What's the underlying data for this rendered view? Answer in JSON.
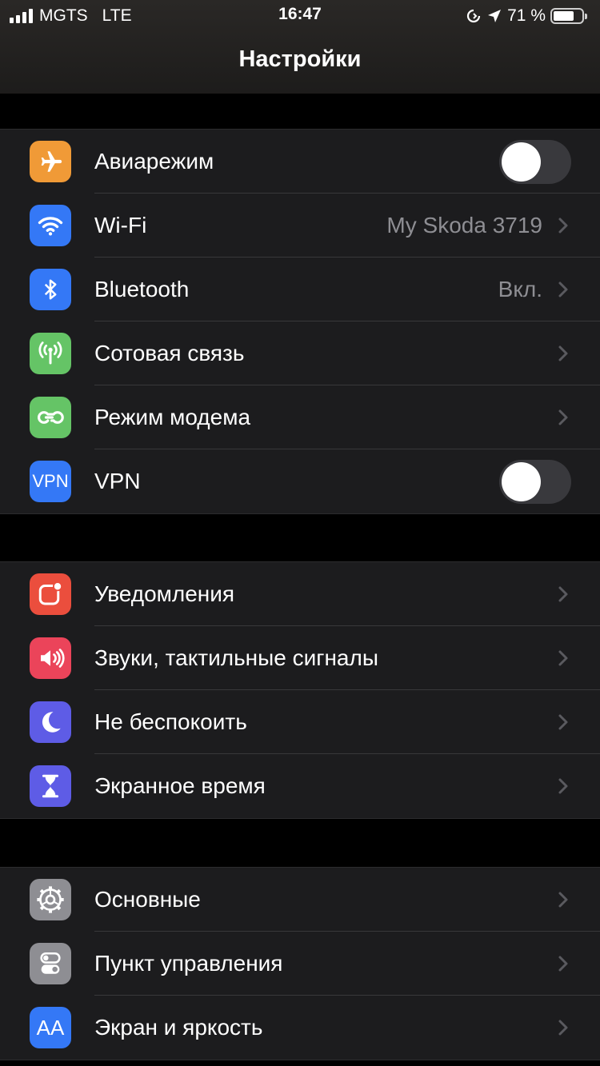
{
  "status_bar": {
    "carrier": "MGTS",
    "network": "LTE",
    "time": "16:47",
    "battery": "71 %"
  },
  "header": {
    "title": "Настройки"
  },
  "groups": [
    {
      "items": [
        {
          "label": "Авиарежим",
          "icon": "airplane-icon",
          "color": "#f09a37",
          "control": "toggle",
          "toggle_on": false
        },
        {
          "label": "Wi-Fi",
          "value": "My Skoda 3719",
          "icon": "wifi-icon",
          "color": "#3478f6",
          "control": "chevron"
        },
        {
          "label": "Bluetooth",
          "value": "Вкл.",
          "icon": "bluetooth-icon",
          "color": "#3478f6",
          "control": "chevron"
        },
        {
          "label": "Сотовая связь",
          "icon": "cellular-icon",
          "color": "#65c466",
          "control": "chevron"
        },
        {
          "label": "Режим модема",
          "icon": "hotspot-icon",
          "color": "#65c466",
          "control": "chevron"
        },
        {
          "label": "VPN",
          "icon": "vpn-icon",
          "icon_text": "VPN",
          "color": "#3478f6",
          "control": "toggle",
          "toggle_on": false
        }
      ]
    },
    {
      "items": [
        {
          "label": "Уведомления",
          "icon": "notifications-icon",
          "color": "#eb4e3d",
          "control": "chevron"
        },
        {
          "label": "Звуки, тактильные сигналы",
          "icon": "sounds-icon",
          "color": "#eb445a",
          "control": "chevron"
        },
        {
          "label": "Не беспокоить",
          "icon": "moon-icon",
          "color": "#5e5ce6",
          "control": "chevron"
        },
        {
          "label": "Экранное время",
          "icon": "hourglass-icon",
          "color": "#5e5ce6",
          "control": "chevron"
        }
      ]
    },
    {
      "items": [
        {
          "label": "Основные",
          "icon": "gear-icon",
          "color": "#8e8e93",
          "control": "chevron"
        },
        {
          "label": "Пункт управления",
          "icon": "control-center-icon",
          "color": "#8e8e93",
          "control": "chevron"
        },
        {
          "label": "Экран и яркость",
          "icon": "display-brightness-icon",
          "icon_text": "AA",
          "color": "#3478f6",
          "control": "chevron"
        }
      ]
    }
  ]
}
